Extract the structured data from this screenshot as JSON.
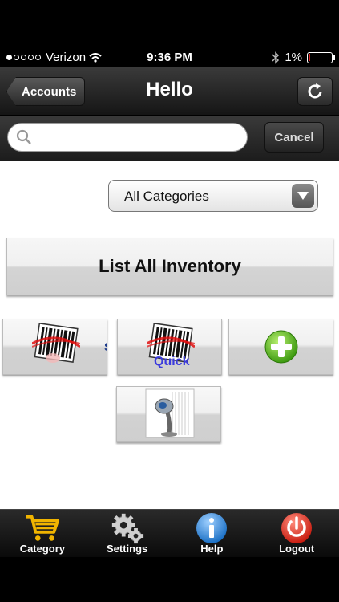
{
  "status_bar": {
    "carrier": "Verizon",
    "time": "9:36 PM",
    "battery": "1%",
    "signal_bars_filled": 1,
    "signal_bars_total": 5,
    "battery_level": 0.01
  },
  "nav": {
    "back_label": "Accounts",
    "title": "Hello"
  },
  "search": {
    "placeholder": "",
    "value": "",
    "cancel_label": "Cancel"
  },
  "category_select": {
    "selected": "All Categories"
  },
  "list_all_label": "List All Inventory",
  "tiles": {
    "scan_label_fragment": "S",
    "quick_label": "Quick",
    "lookup_label_fragment": "l"
  },
  "tab_bar": {
    "items": [
      {
        "label": "Category",
        "icon": "cart-icon",
        "color": "#f0b400"
      },
      {
        "label": "Settings",
        "icon": "gear-icon",
        "color": "#cfcfcf"
      },
      {
        "label": "Help",
        "icon": "info-icon",
        "color": "#2f86d6"
      },
      {
        "label": "Logout",
        "icon": "power-icon",
        "color": "#e02a1e"
      }
    ]
  }
}
